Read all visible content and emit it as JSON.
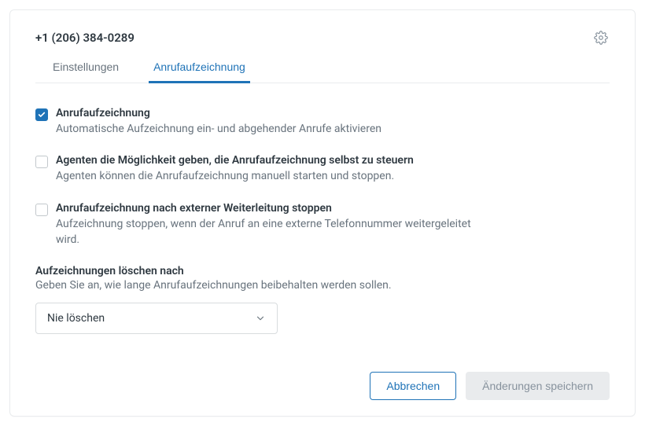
{
  "header": {
    "phone": "+1 (206) 384-0289"
  },
  "tabs": [
    {
      "label": "Einstellungen",
      "active": false
    },
    {
      "label": "Anrufaufzeichnung",
      "active": true
    }
  ],
  "options": [
    {
      "title": "Anrufaufzeichnung",
      "desc": "Automatische Aufzeichnung ein- und abgehender Anrufe aktivieren",
      "checked": true
    },
    {
      "title": "Agenten die Möglichkeit geben, die Anrufaufzeichnung selbst zu steuern",
      "desc": "Agenten können die Anrufaufzeichnung manuell starten und stoppen.",
      "checked": false
    },
    {
      "title": "Anrufaufzeichnung nach externer Weiterleitung stoppen",
      "desc": "Aufzeichnung stoppen, wenn der Anruf an eine externe Telefonnummer weitergeleitet wird.",
      "checked": false
    }
  ],
  "retention": {
    "title": "Aufzeichnungen löschen nach",
    "desc": "Geben Sie an, wie lange Anrufaufzeichnungen beibehalten werden sollen.",
    "selected": "Nie löschen"
  },
  "footer": {
    "cancel": "Abbrechen",
    "save": "Änderungen speichern"
  }
}
